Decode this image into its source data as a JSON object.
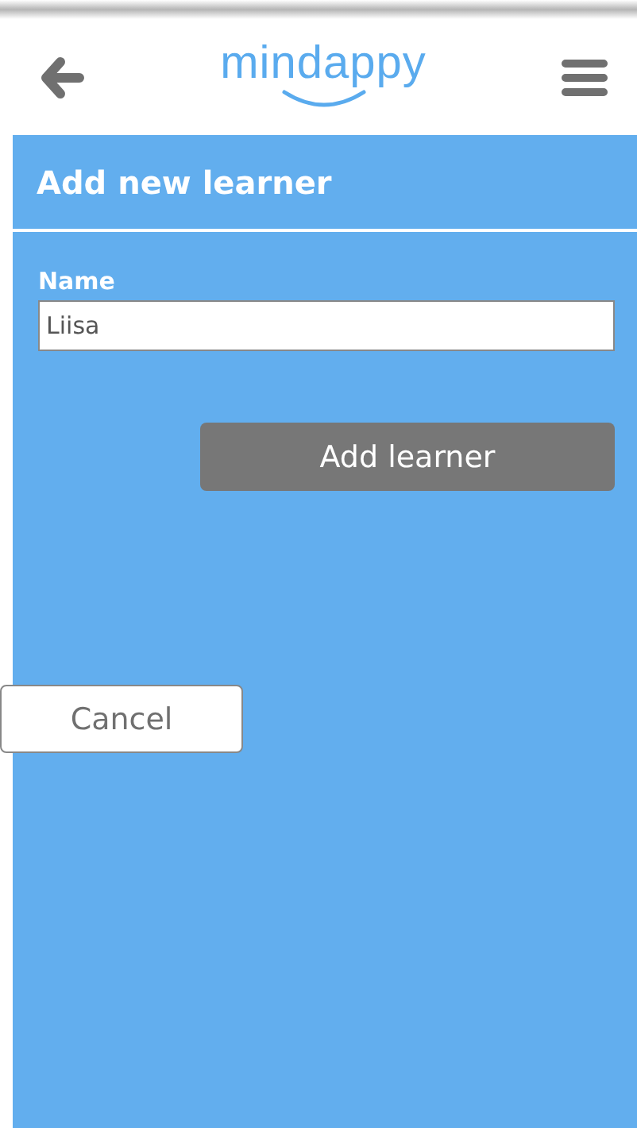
{
  "header": {
    "logo": "mindappy"
  },
  "page_title": "Add new learner",
  "form": {
    "name_label": "Name",
    "name_value": "Liisa"
  },
  "buttons": {
    "submit": "Add learner",
    "cancel": "Cancel"
  }
}
